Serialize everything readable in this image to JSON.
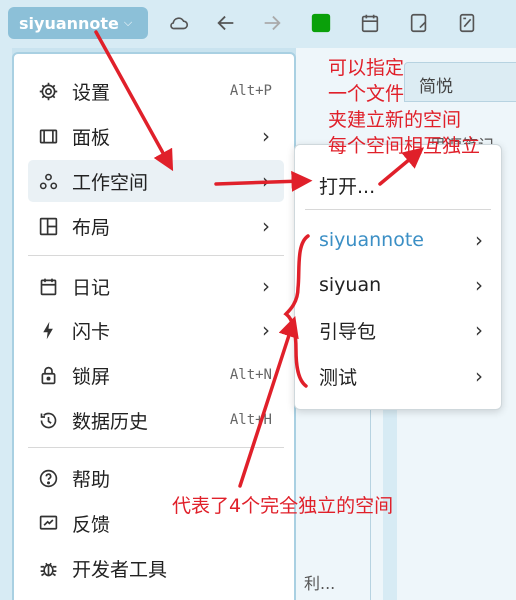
{
  "workspace_button": {
    "label": "siyuannote"
  },
  "background": {
    "tab_label": "简悦",
    "partial_text_1": "思源笔记",
    "partial_text_2": "利..."
  },
  "main_menu": {
    "items": [
      {
        "label": "设置",
        "shortcut": "Alt+P",
        "icon": "gear-icon"
      },
      {
        "label": "面板",
        "icon": "panel-icon"
      },
      {
        "label": "工作空间",
        "icon": "workspace-icon"
      },
      {
        "label": "布局",
        "icon": "layout-icon"
      },
      {
        "label": "日记",
        "icon": "calendar-icon"
      },
      {
        "label": "闪卡",
        "icon": "flash-icon"
      },
      {
        "label": "锁屏",
        "shortcut": "Alt+N",
        "icon": "lock-icon"
      },
      {
        "label": "数据历史",
        "shortcut": "Alt+H",
        "icon": "history-icon"
      },
      {
        "label": "帮助",
        "icon": "help-icon"
      },
      {
        "label": "反馈",
        "icon": "feedback-icon"
      },
      {
        "label": "开发者工具",
        "icon": "bug-icon"
      }
    ]
  },
  "sub_menu": {
    "open_label": "打开...",
    "workspaces": [
      {
        "label": "siyuannote"
      },
      {
        "label": "siyuan"
      },
      {
        "label": "引导包"
      },
      {
        "label": "测试"
      }
    ]
  },
  "annotations": {
    "top_note": "可以指定\n一个文件\n夹建立新的空间\n每个空间相互独立",
    "bottom_note": "代表了4个完全独立的空间"
  },
  "colors": {
    "accent": "#3b8fc5",
    "annotation": "#e0202a",
    "workspace_button": "#8cc0d8"
  }
}
